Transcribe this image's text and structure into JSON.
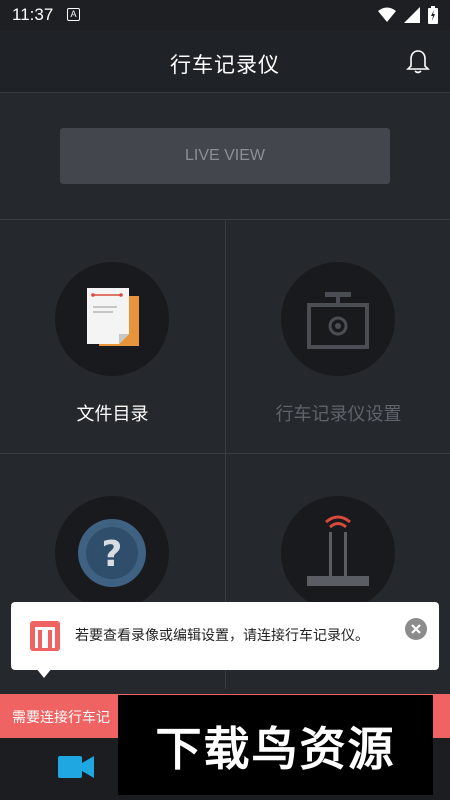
{
  "status_bar": {
    "time": "11:37",
    "notif_letter": "A"
  },
  "header": {
    "title": "行车记录仪"
  },
  "live_view": {
    "label": "LIVE VIEW"
  },
  "tiles": [
    {
      "label": "文件目录",
      "icon": "file-folder-icon",
      "enabled": true
    },
    {
      "label": "行车记录仪设置",
      "icon": "camera-settings-icon",
      "enabled": false
    },
    {
      "label": "",
      "icon": "help-icon"
    },
    {
      "label": "",
      "icon": "wifi-router-icon"
    }
  ],
  "popup": {
    "message": "若要查看录像或编辑设置，请连接行车记录仪。"
  },
  "warning_bar": {
    "text": "需要连接行车记"
  },
  "watermark": {
    "text": "下载鸟资源"
  },
  "colors": {
    "accent_blue": "#1ea7e0",
    "warning": "#f06363",
    "disabled_text": "#5f646b"
  }
}
